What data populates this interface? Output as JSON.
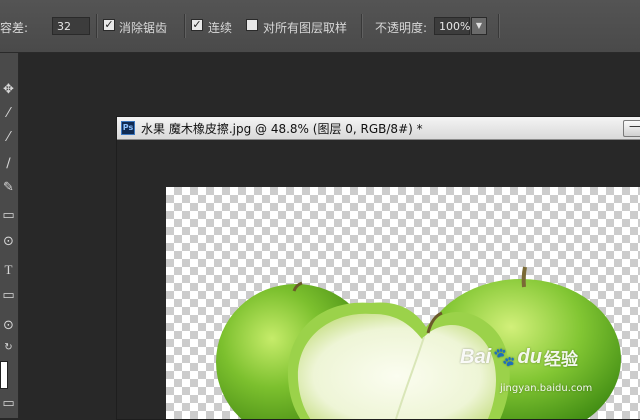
{
  "options_bar": {
    "tolerance_label": "容差:",
    "tolerance_value": "32",
    "anti_alias_label": "消除锯齿",
    "anti_alias_checked": true,
    "contiguous_label": "连续",
    "contiguous_checked": true,
    "sample_all_layers_label": "对所有图层取样",
    "sample_all_layers_checked": false,
    "opacity_label": "不透明度:",
    "opacity_value": "100%"
  },
  "toolbar": {
    "tools": [
      "move-icon",
      "brush-icon",
      "eyedropper-icon",
      "brush-icon",
      "pen-icon",
      "gradient-icon",
      "magnifier-icon",
      "type-icon",
      "rectangle-icon",
      "zoom-icon",
      "rotate-icon"
    ],
    "type_tool_glyph": "T"
  },
  "document": {
    "app_badge": "Ps",
    "title": "水果 魔木橡皮擦.jpg @ 48.8% (图层 0, RGB/8#) *",
    "minimize_glyph": "—"
  },
  "watermark": {
    "logo": "Bai",
    "logo_suffix": "du",
    "chinese": "经验",
    "url": "jingyan.baidu.com"
  },
  "colors": {
    "panel": "#4a4a4a",
    "workspace": "#282828",
    "apple_green": "#7cc02e"
  }
}
